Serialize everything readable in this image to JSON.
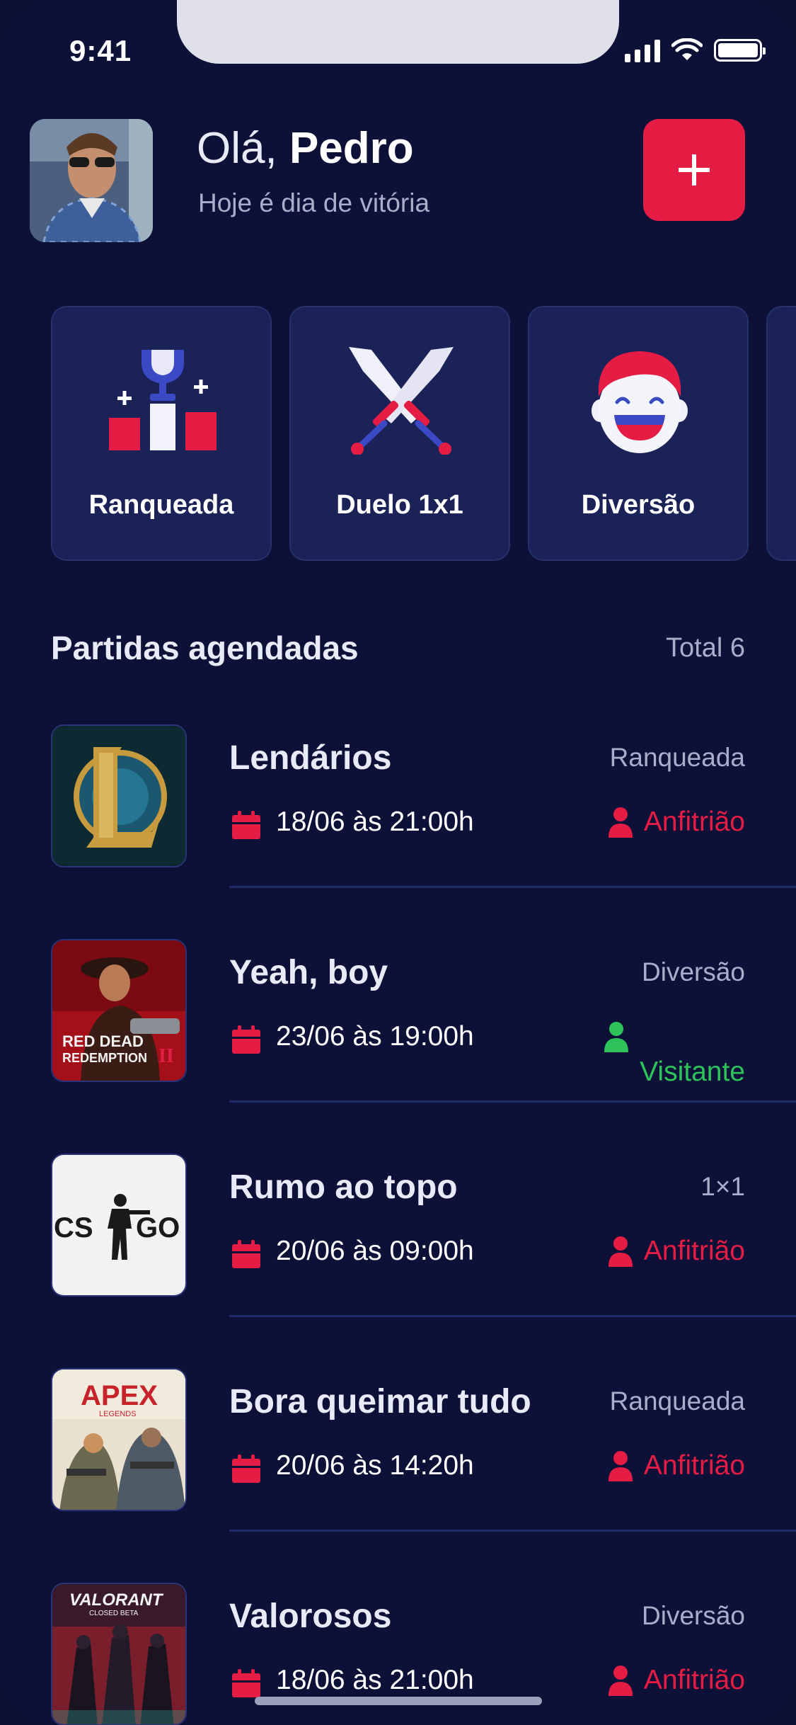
{
  "status": {
    "time": "9:41"
  },
  "header": {
    "greeting_prefix": "Olá, ",
    "user_name": "Pedro",
    "subtitle": "Hoje é dia de vitória",
    "add_label": "+"
  },
  "categories": [
    {
      "label": "Ranqueada",
      "icon": "podium-trophy-icon"
    },
    {
      "label": "Duelo 1x1",
      "icon": "crossed-swords-icon"
    },
    {
      "label": "Diversão",
      "icon": "laughing-face-icon"
    }
  ],
  "section": {
    "title": "Partidas agendadas",
    "total": "Total 6"
  },
  "matches": [
    {
      "name": "Lendários",
      "type": "Ranqueada",
      "date": "18/06 às 21:00h",
      "role": "Anfitrião",
      "game_art": "L"
    },
    {
      "name": "Yeah, boy",
      "type": "Diversão",
      "date": "23/06 às 19:00h",
      "role": "Visitante",
      "game_art": "RED DEAD REDEMPTION"
    },
    {
      "name": "Rumo ao topo",
      "type": "1×1",
      "date": "20/06 às 09:00h",
      "role": "Anfitrião",
      "game_art": "CS GO"
    },
    {
      "name": "Bora queimar tudo",
      "type": "Ranqueada",
      "date": "20/06 às 14:20h",
      "role": "Anfitrião",
      "game_art": "APEX"
    },
    {
      "name": "Valorosos",
      "type": "Diversão",
      "date": "18/06 às 21:00h",
      "role": "Anfitrião",
      "game_art": "VALORANT"
    }
  ],
  "colors": {
    "background": "#0d1137",
    "card": "#1a2258",
    "accent": "#e51c44",
    "guest": "#2ec35a",
    "muted": "#a9aecc"
  }
}
